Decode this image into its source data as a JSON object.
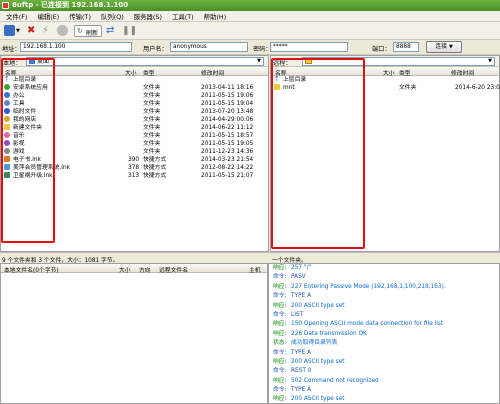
{
  "window": {
    "title": "8uftp - 已连接到 192.168.1.100"
  },
  "menu": [
    "文件(F)",
    "编辑(E)",
    "传输(T)",
    "队列(Q)",
    "服务器(S)",
    "工具(T)",
    "帮助(H)"
  ],
  "toolbar": {
    "refresh_label": "刷新"
  },
  "connection": {
    "address_label": "地址：",
    "address_value": "192.168.1.100",
    "user_label": "用户名：",
    "user_value": "anonymous",
    "password_label": "密码：",
    "password_value": "*****",
    "port_label": "端口：",
    "port_value": "8888",
    "connect_label": "连接"
  },
  "local": {
    "path_label": "本地：",
    "path_value": "桌面",
    "columns": [
      "名称",
      "大小",
      "类型",
      "修改时间"
    ],
    "rows": [
      {
        "name": "上层目录",
        "size": "",
        "type": "",
        "date": "",
        "icon": "up-arrow-icon"
      },
      {
        "name": "安卓系统应用",
        "size": "",
        "type": "文件夹",
        "date": "2013-04-11 18:16",
        "icon": "folder-icon"
      },
      {
        "name": "办公",
        "size": "",
        "type": "文件夹",
        "date": "2011-05-15 19:06",
        "icon": "folder-icon"
      },
      {
        "name": "工具",
        "size": "",
        "type": "文件夹",
        "date": "2011-05-15 19:04",
        "icon": "folder-icon"
      },
      {
        "name": "临时文件",
        "size": "",
        "type": "文件夹",
        "date": "2013-07-20 13:48",
        "icon": "folder-icon"
      },
      {
        "name": "我的网店",
        "size": "",
        "type": "文件夹",
        "date": "2014-04-29 00:06",
        "icon": "folder-icon"
      },
      {
        "name": "新建文件夹",
        "size": "",
        "type": "文件夹",
        "date": "2014-06-22 11:12",
        "icon": "folder-icon"
      },
      {
        "name": "音乐",
        "size": "",
        "type": "文件夹",
        "date": "2011-05-15 18:57",
        "icon": "folder-icon"
      },
      {
        "name": "影视",
        "size": "",
        "type": "文件夹",
        "date": "2011-05-15 19:05",
        "icon": "folder-icon"
      },
      {
        "name": "游戏",
        "size": "",
        "type": "文件夹",
        "date": "2011-12-23 14:36",
        "icon": "folder-icon"
      },
      {
        "name": "电子书.lnk",
        "size": "390",
        "type": "快捷方式",
        "date": "2014-03-23 21:54",
        "icon": "shortcut-icon"
      },
      {
        "name": "美萍会员管理系统.lnk",
        "size": "378",
        "type": "快捷方式",
        "date": "2012-08-22 14:22",
        "icon": "shortcut-icon"
      },
      {
        "name": "卫星祸升级.lnk",
        "size": "313",
        "type": "快捷方式",
        "date": "2011-05-15 21:07",
        "icon": "shortcut-icon"
      }
    ],
    "status": "9 个文件夹和 3 个文件，大小：1081 字节。"
  },
  "remote": {
    "path_label": "远程：",
    "columns": [
      "名称",
      "大小",
      "类型",
      "修改时间"
    ],
    "rows": [
      {
        "name": "上层目录",
        "size": "",
        "type": "",
        "date": "",
        "icon": "up-arrow-icon"
      },
      {
        "name": "mnt",
        "size": "",
        "type": "文件夹",
        "date": "2014-6-20 23:00",
        "icon": "folder-icon"
      }
    ],
    "status": "一个文件夹。"
  },
  "queue": {
    "columns": [
      "本地文件名(0个字节)",
      "大小",
      "方向",
      "远程文件名",
      "主机"
    ]
  },
  "log": [
    {
      "prefix": "响应:",
      "text": "257 \"/\"",
      "kind": "resp"
    },
    {
      "prefix": "命令:",
      "text": "PASV",
      "kind": "cmd"
    },
    {
      "prefix": "响应:",
      "text": "227 Entering Passive Mode (192,168,1,100,218,163).",
      "kind": "resp"
    },
    {
      "prefix": "命令:",
      "text": "TYPE A",
      "kind": "cmd"
    },
    {
      "prefix": "响应:",
      "text": "200 ASCII type set",
      "kind": "resp"
    },
    {
      "prefix": "命令:",
      "text": "LIST",
      "kind": "cmd"
    },
    {
      "prefix": "响应:",
      "text": "150 Opening ASCII mode data connection for file list",
      "kind": "resp"
    },
    {
      "prefix": "响应:",
      "text": "226 Data transmission OK",
      "kind": "resp"
    },
    {
      "prefix": "状态:",
      "text": "成功取得目录列表",
      "kind": "resp"
    },
    {
      "prefix": "命令:",
      "text": "TYPE A",
      "kind": "cmd"
    },
    {
      "prefix": "响应:",
      "text": "200 ASCII type set",
      "kind": "resp"
    },
    {
      "prefix": "命令:",
      "text": "REST 0",
      "kind": "cmd"
    },
    {
      "prefix": "响应:",
      "text": "502 Command not recognized",
      "kind": "resp"
    },
    {
      "prefix": "命令:",
      "text": "TYPE A",
      "kind": "cmd"
    },
    {
      "prefix": "响应:",
      "text": "200 ASCII type set",
      "kind": "resp"
    }
  ],
  "colors": {
    "title_bar": "#4a8f27",
    "highlight_box": "#e01010",
    "log_response": "#0a6ad6",
    "log_prefix": "#0a8a0a"
  }
}
